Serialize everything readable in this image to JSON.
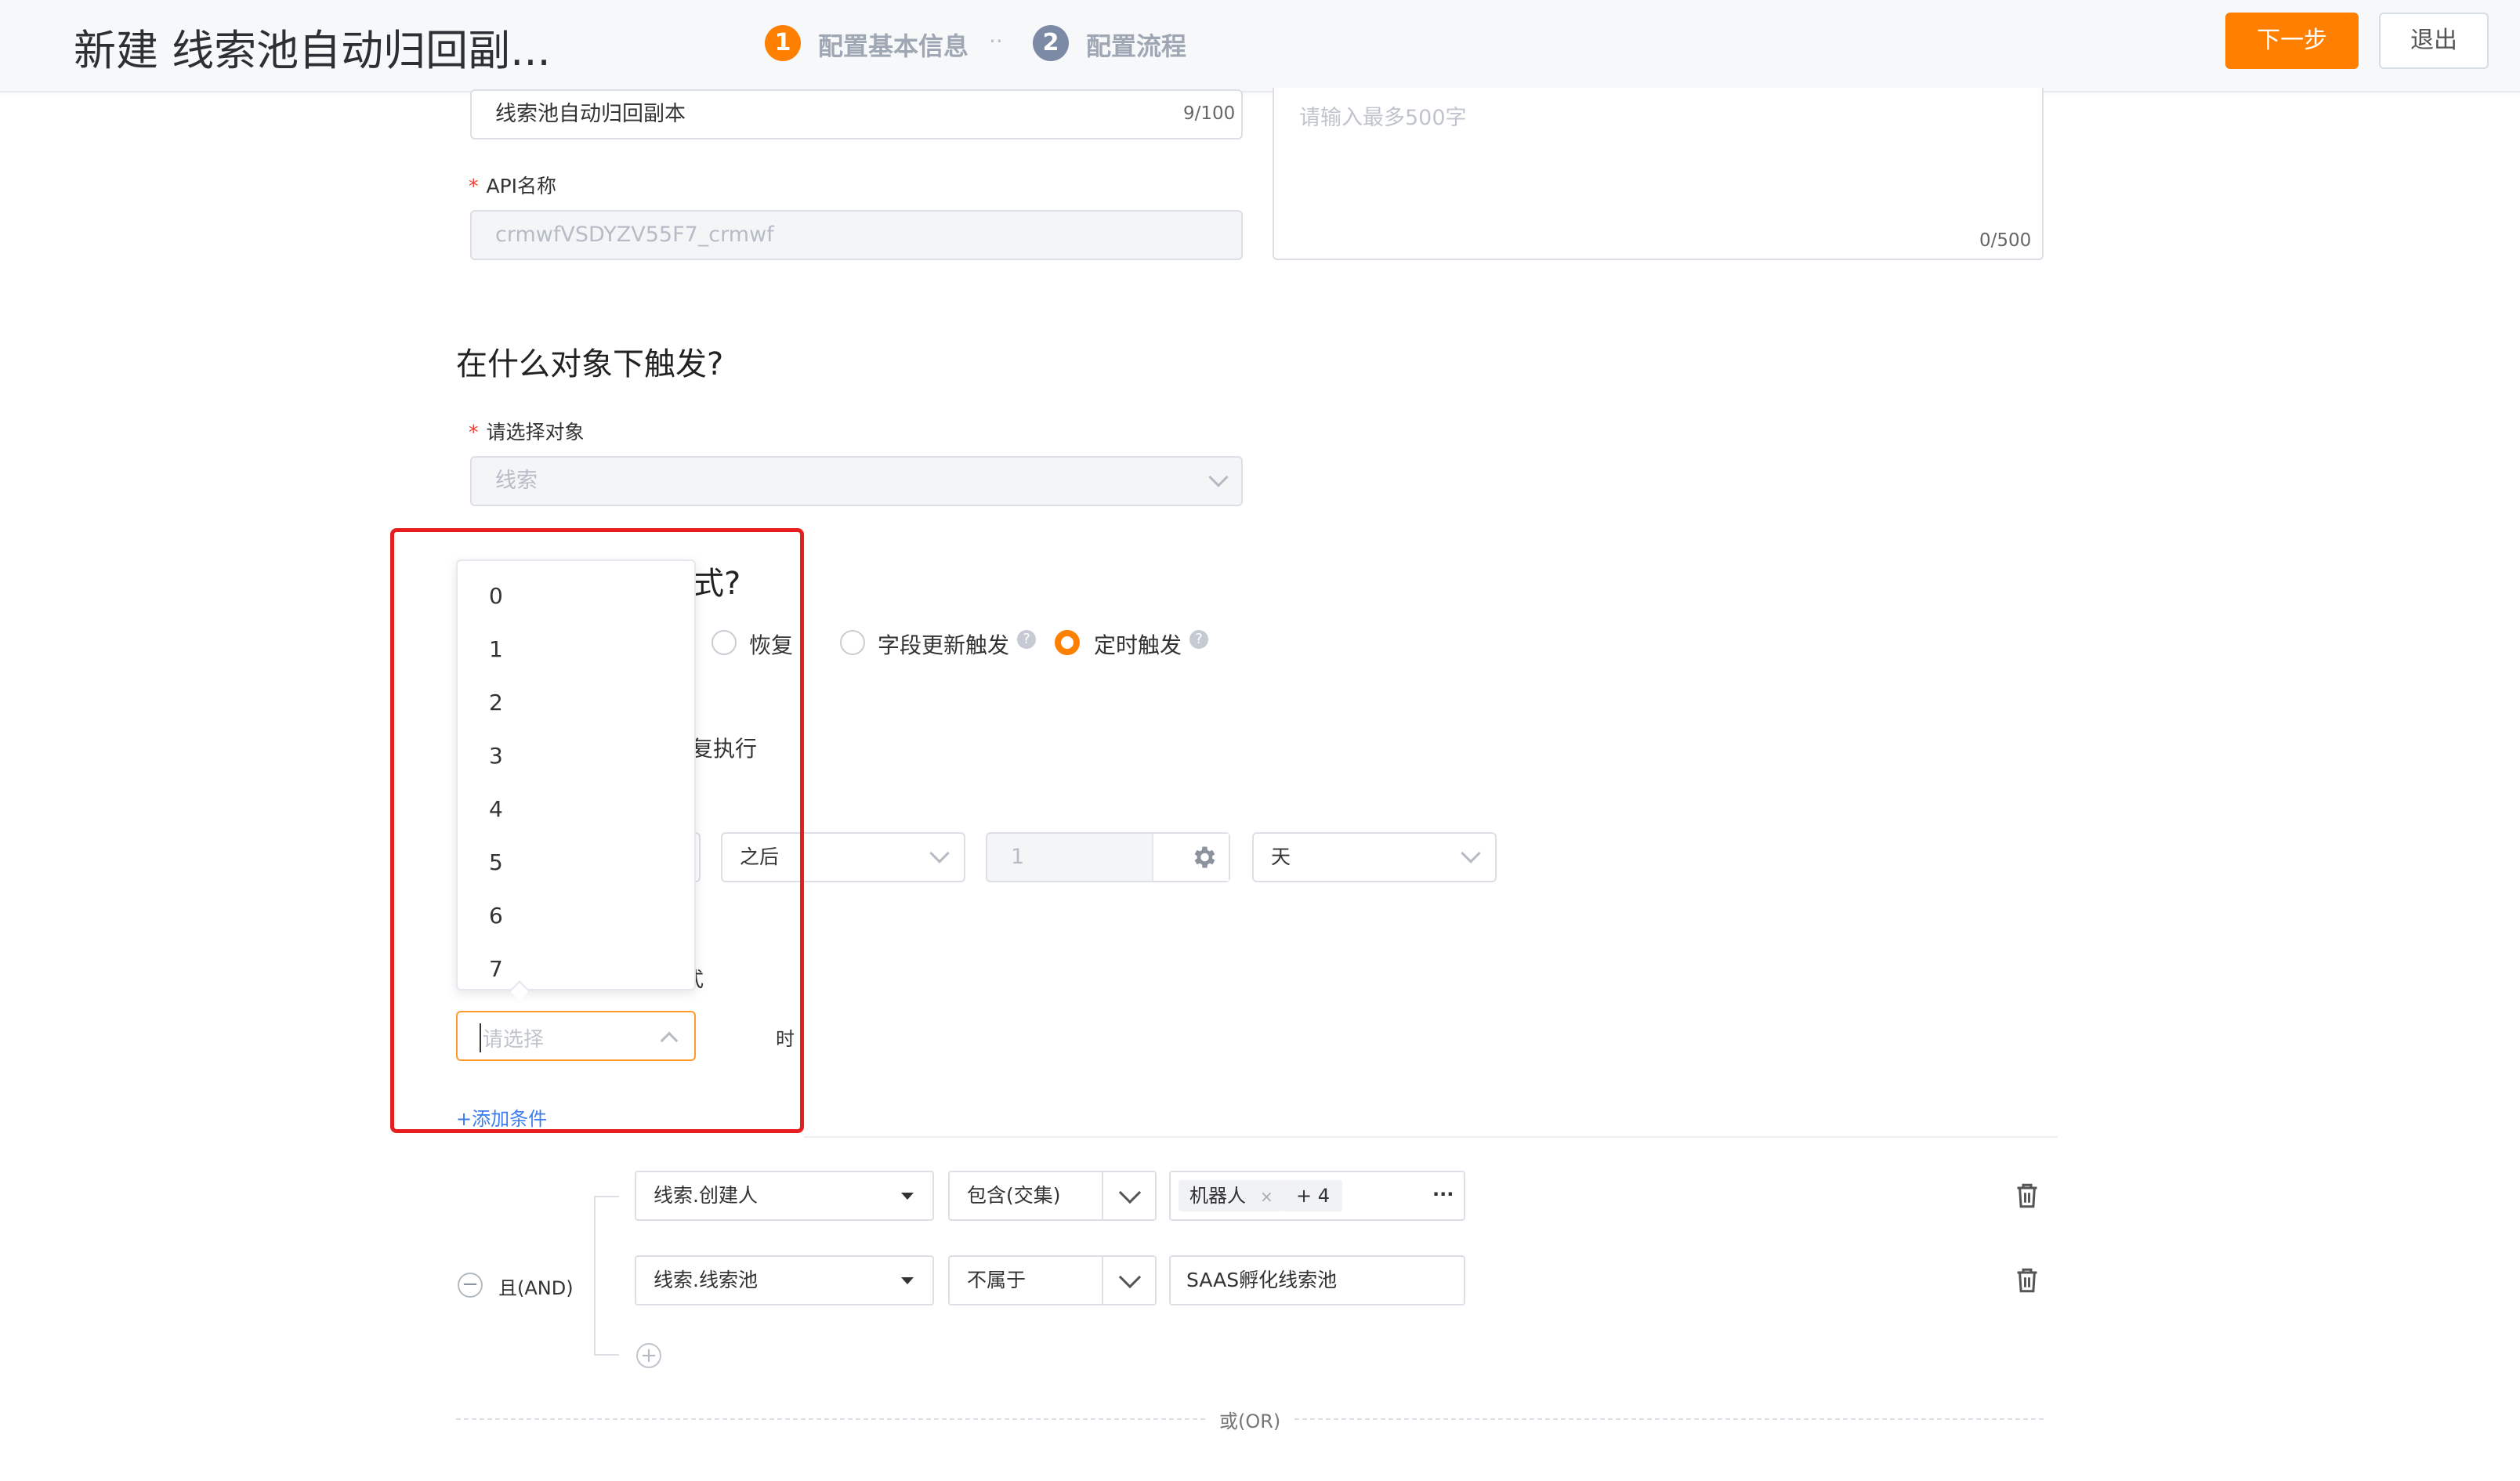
{
  "header": {
    "title": "新建 线索池自动归回副...",
    "steps": [
      {
        "number": "1",
        "label": "配置基本信息",
        "color": "#ff7f00"
      },
      {
        "number": "2",
        "label": "配置流程",
        "color": "#7d8aa5"
      }
    ],
    "step_separator": "··",
    "next_button": "下一步",
    "exit_button": "退出"
  },
  "basic": {
    "name_value": "线索池自动归回副本",
    "name_counter": "9/100",
    "api_label": "API名称",
    "api_value": "crmwfVSDYZV55F7_crmwf",
    "desc_placeholder": "请输入最多500字",
    "desc_counter": "0/500"
  },
  "trigger_object": {
    "heading": "在什么对象下触发?",
    "label": "请选择对象",
    "value": "线索"
  },
  "trigger_type": {
    "heading_visible": "式?",
    "radios": [
      {
        "label": "恢复",
        "checked": false
      },
      {
        "label": "字段更新触发",
        "checked": false,
        "help": true
      },
      {
        "label": "定时触发",
        "checked": true,
        "help": true
      }
    ],
    "repeat_fragment": "复执行",
    "after_value": "之后",
    "amount_value": "1",
    "unit_value": "天",
    "time_fragment": "式",
    "hour_placeholder": "请选择",
    "hour_suffix": "时",
    "add_condition": "+添加条件"
  },
  "hour_dropdown": {
    "options": [
      "0",
      "1",
      "2",
      "3",
      "4",
      "5",
      "6",
      "7"
    ]
  },
  "filters": {
    "and_label": "且(AND)",
    "rows": [
      {
        "field": "线索.创建人",
        "operator": "包含(交集)",
        "tag": "机器人",
        "more": "+ 4",
        "ellipsis": "···"
      },
      {
        "field": "线索.线索池",
        "operator": "不属于",
        "value": "SAAS孵化线索池"
      }
    ],
    "or_label": "或(OR)"
  },
  "colors": {
    "accent": "#ff7f00",
    "link": "#3c7df0",
    "highlight_box": "#e61e1e"
  }
}
